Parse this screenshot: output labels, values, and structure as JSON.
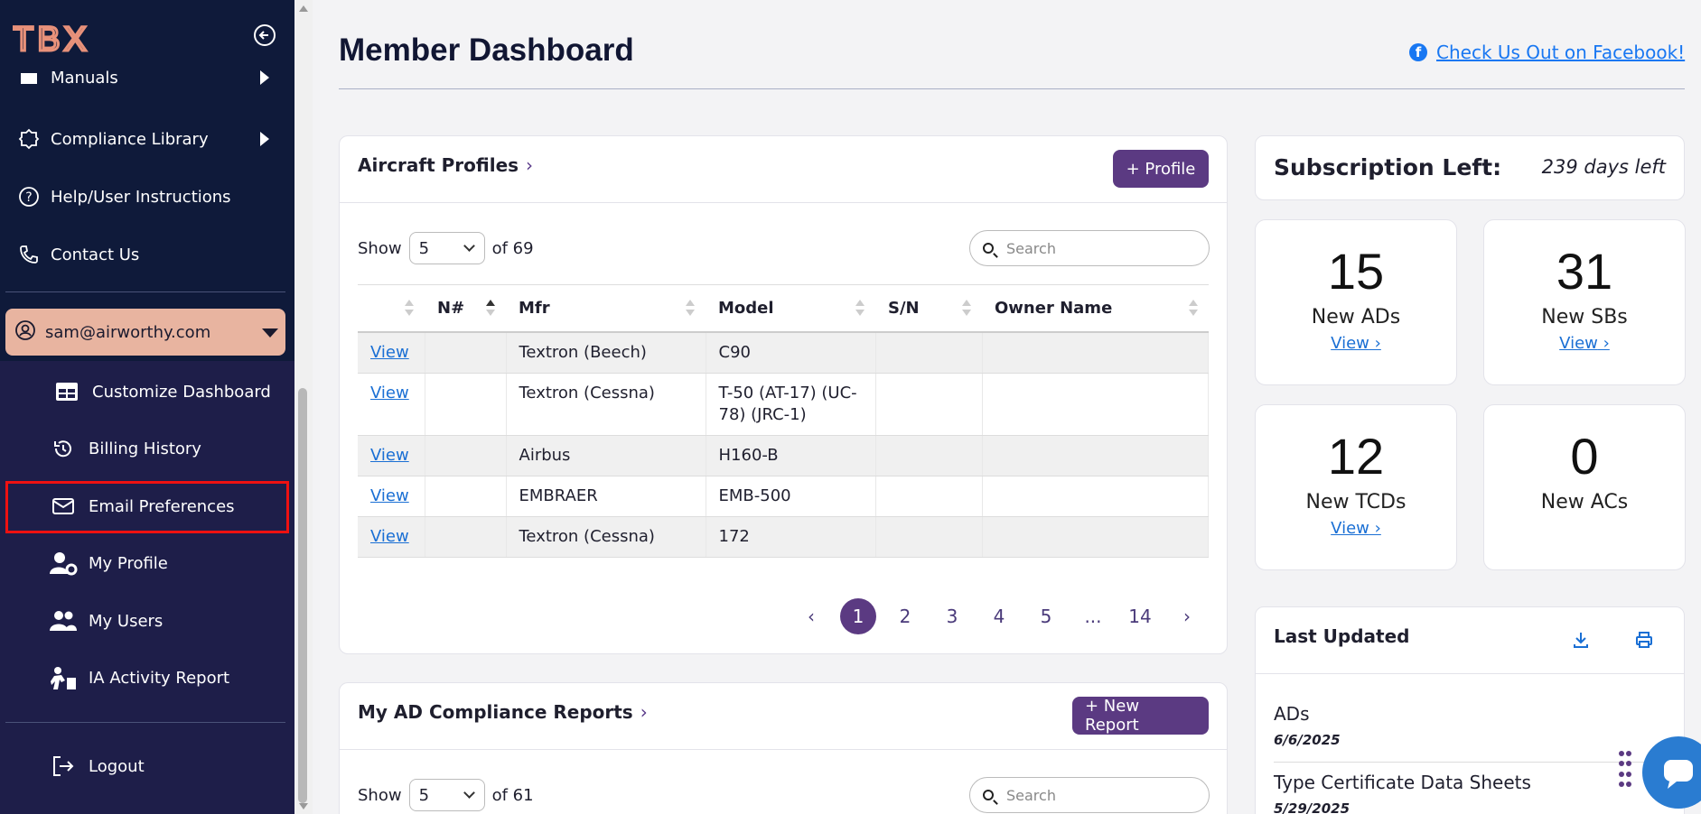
{
  "sidebar": {
    "logo_text": "TBX",
    "items": [
      {
        "label": "Manuals",
        "icon": "manual-icon"
      },
      {
        "label": "Compliance Library",
        "icon": "badge-icon"
      },
      {
        "label": "Help/User Instructions",
        "icon": "help-icon"
      },
      {
        "label": "Contact Us",
        "icon": "phone-icon"
      }
    ],
    "user_email": "sam@airworthy.com",
    "user_items": [
      {
        "label": "Customize Dashboard",
        "icon": "dashboard-icon"
      },
      {
        "label": "Billing History",
        "icon": "history-icon"
      },
      {
        "label": "Email Preferences",
        "icon": "envelope-icon"
      },
      {
        "label": "My Profile",
        "icon": "user-gear-icon"
      },
      {
        "label": "My Users",
        "icon": "users-icon"
      },
      {
        "label": "IA Activity Report",
        "icon": "report-icon"
      }
    ],
    "logout": "Logout"
  },
  "header": {
    "title": "Member Dashboard",
    "facebook_link": "Check Us Out on Facebook!"
  },
  "aircraft": {
    "title": "Aircraft Profiles",
    "add_button": "+ Profile",
    "show_label": "Show",
    "page_size": "5",
    "of_label": "of 69",
    "search_placeholder": "Search",
    "columns": [
      "",
      "N#",
      "Mfr",
      "Model",
      "S/N",
      "Owner Name"
    ],
    "rows": [
      {
        "link": "View",
        "n": "",
        "mfr": "Textron (Beech)",
        "model": "C90",
        "sn": "",
        "owner": ""
      },
      {
        "link": "View",
        "n": "",
        "mfr": "Textron (Cessna)",
        "model": "T-50 (AT-17) (UC-78) (JRC-1)",
        "sn": "",
        "owner": ""
      },
      {
        "link": "View",
        "n": "",
        "mfr": "Airbus",
        "model": "H160-B",
        "sn": "",
        "owner": ""
      },
      {
        "link": "View",
        "n": "",
        "mfr": "EMBRAER",
        "model": "EMB-500",
        "sn": "",
        "owner": ""
      },
      {
        "link": "View",
        "n": "",
        "mfr": "Textron (Cessna)",
        "model": "172",
        "sn": "",
        "owner": ""
      }
    ],
    "pages": [
      "1",
      "2",
      "3",
      "4",
      "5",
      "...",
      "14"
    ]
  },
  "reports": {
    "title": "My AD Compliance Reports",
    "add_button": "+ New Report",
    "show_label": "Show",
    "page_size": "5",
    "of_label": "of 61",
    "search_placeholder": "Search"
  },
  "subscription": {
    "label": "Subscription Left:",
    "value": "239 days left"
  },
  "stats": [
    {
      "num": "15",
      "label": "New ADs",
      "view": "View"
    },
    {
      "num": "31",
      "label": "New SBs",
      "view": "View"
    },
    {
      "num": "12",
      "label": "New TCDs",
      "view": "View"
    },
    {
      "num": "0",
      "label": "New ACs",
      "view": ""
    }
  ],
  "last_updated": {
    "title": "Last Updated",
    "items": [
      {
        "label": "ADs",
        "date": "6/6/2025"
      },
      {
        "label": "Type Certificate Data Sheets",
        "date": "5/29/2025"
      }
    ]
  },
  "colors": {
    "sidebar_bg": "#0f1a3a",
    "submenu_bg": "#1e1e49",
    "accent_purple": "#5b3a82",
    "user_highlight": "#e8b4a0",
    "link_blue": "#1a6fd4"
  }
}
